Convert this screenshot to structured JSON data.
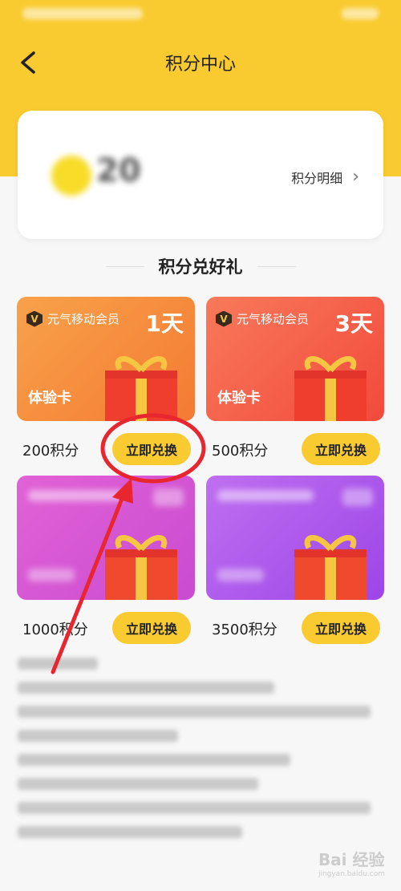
{
  "header": {
    "title": "积分中心",
    "back_icon": "back-arrow-icon"
  },
  "points": {
    "balance": "20",
    "detail_label": "积分明细",
    "detail_icon": "chevron-right-icon",
    "coin_icon": "coin-icon"
  },
  "section": {
    "title": "积分兑好礼"
  },
  "rewards": [
    {
      "brand": "元气移动会员",
      "days": "1天",
      "card_label": "体验卡",
      "points": "200积分",
      "button": "立即兑换"
    },
    {
      "brand": "元气移动会员",
      "days": "3天",
      "card_label": "体验卡",
      "points": "500积分",
      "button": "立即兑换"
    },
    {
      "points": "1000积分",
      "button": "立即兑换"
    },
    {
      "points": "3500积分",
      "button": "立即兑换"
    }
  ],
  "vip_badge": "V",
  "watermark": {
    "text": "Bai 经验",
    "sub": "jingyan.baidu.com"
  },
  "colors": {
    "accent": "#f9cb30",
    "annotation": "#e8262f"
  }
}
